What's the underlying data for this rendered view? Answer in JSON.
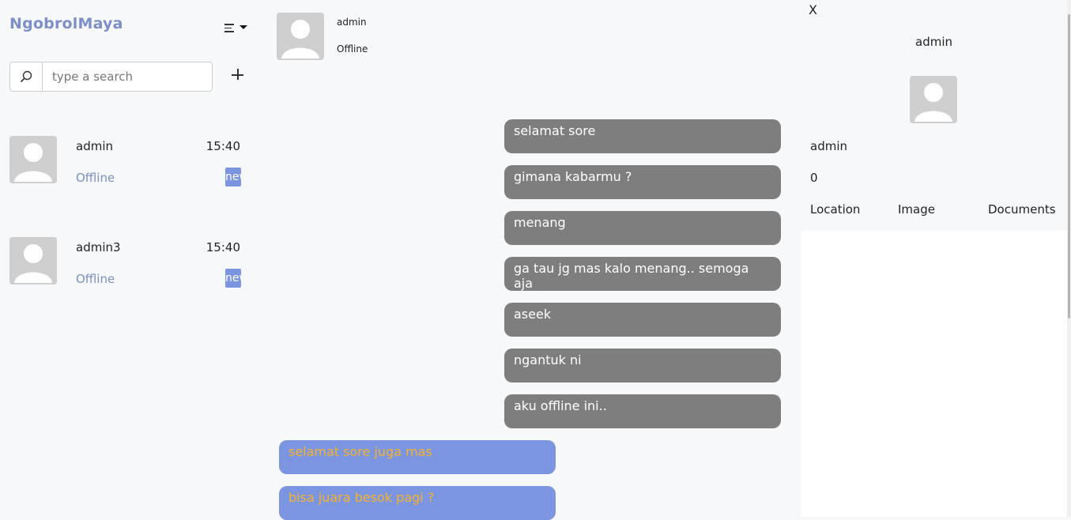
{
  "app": {
    "brand": "NgobrolMaya"
  },
  "search": {
    "placeholder": "type a search",
    "value": ""
  },
  "contacts": [
    {
      "name": "admin",
      "time": "15:40",
      "status": "Offline",
      "badge": "new"
    },
    {
      "name": "admin3",
      "time": "15:40",
      "status": "Offline",
      "badge": "new"
    }
  ],
  "chat": {
    "name": "admin",
    "status": "Offline",
    "messages": [
      {
        "text": "selamat sore",
        "direction": "out"
      },
      {
        "text": "gimana kabarmu ?",
        "direction": "out"
      },
      {
        "text": "menang",
        "direction": "out"
      },
      {
        "text": "ga tau jg mas kalo menang.. semoga aja",
        "direction": "out"
      },
      {
        "text": "aseek",
        "direction": "out"
      },
      {
        "text": "ngantuk ni",
        "direction": "out"
      },
      {
        "text": "aku offline ini..",
        "direction": "out"
      },
      {
        "text": "selamat sore juga mas",
        "direction": "in"
      },
      {
        "text": "bisa juara besok pagi ?",
        "direction": "in"
      }
    ]
  },
  "panel": {
    "close_label": "X",
    "title": "admin",
    "name": "admin",
    "count": "0",
    "tabs": [
      "Location",
      "Image",
      "Documents"
    ]
  },
  "colors": {
    "brand": "#7c8fc8",
    "outgoing_bubble": "#7e7e7e",
    "incoming_bubble": "#7c95e0",
    "incoming_text": "#f5b22e",
    "badge": "#7c95e0"
  },
  "icons": {
    "search": "search-icon",
    "menu": "menu-icon",
    "add": "plus-icon",
    "avatar": "user-avatar-icon"
  }
}
